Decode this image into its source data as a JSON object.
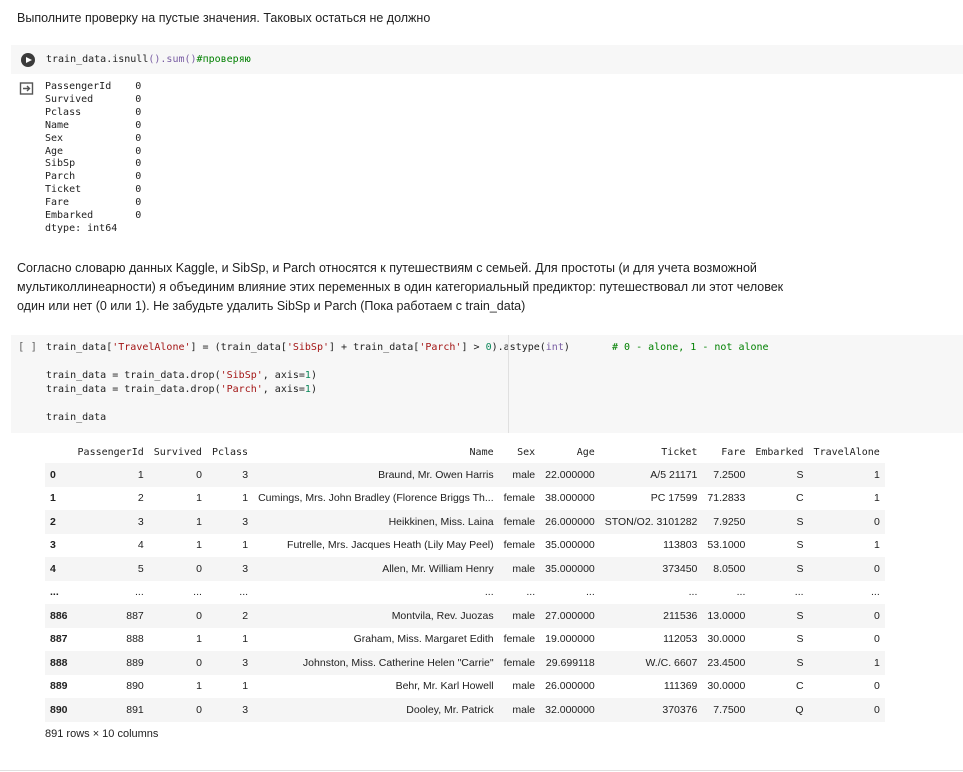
{
  "markdown_1": "Выполните проверку на пустые значения. Таковых остаться не должно",
  "cell_1": {
    "tokens": [
      "train_data.isnull",
      "()",
      ".sum",
      "()",
      "#проверяю"
    ]
  },
  "output_1": {
    "rows": [
      [
        "PassengerId",
        "0"
      ],
      [
        "Survived",
        "0"
      ],
      [
        "Pclass",
        "0"
      ],
      [
        "Name",
        "0"
      ],
      [
        "Sex",
        "0"
      ],
      [
        "Age",
        "0"
      ],
      [
        "SibSp",
        "0"
      ],
      [
        "Parch",
        "0"
      ],
      [
        "Ticket",
        "0"
      ],
      [
        "Fare",
        "0"
      ],
      [
        "Embarked",
        "0"
      ]
    ],
    "dtype": "dtype: int64"
  },
  "markdown_2": "Согласно словарю данных Kaggle, и SibSp, и Parch относятся к путешествиям с семьей. Для простоты (и для учета возможной мультиколлинеарности) я объединим влияние этих переменных в один категориальный предиктор: путешествовал ли этот человек один или нет (0 или 1). Не забудьте удалить SibSp и Parch (Пока работаем с train_data)",
  "cell_2": {
    "exec_count": "[ ]",
    "lines": [
      "train_data['TravelAlone'] = (train_data['SibSp'] + train_data['Parch'] > 0).astype(int)       # 0 - alone, 1 - not alone",
      "",
      "train_data = train_data.drop('SibSp', axis=1)",
      "train_data = train_data.drop('Parch', axis=1)",
      "",
      "train_data"
    ]
  },
  "dataframe": {
    "columns": [
      "",
      "PassengerId",
      "Survived",
      "Pclass",
      "Name",
      "Sex",
      "Age",
      "Ticket",
      "Fare",
      "Embarked",
      "TravelAlone"
    ],
    "rows": [
      [
        "0",
        "1",
        "0",
        "3",
        "Braund, Mr. Owen Harris",
        "male",
        "22.000000",
        "A/5 21171",
        "7.2500",
        "S",
        "1"
      ],
      [
        "1",
        "2",
        "1",
        "1",
        "Cumings, Mrs. John Bradley (Florence Briggs Th...",
        "female",
        "38.000000",
        "PC 17599",
        "71.2833",
        "C",
        "1"
      ],
      [
        "2",
        "3",
        "1",
        "3",
        "Heikkinen, Miss. Laina",
        "female",
        "26.000000",
        "STON/O2. 3101282",
        "7.9250",
        "S",
        "0"
      ],
      [
        "3",
        "4",
        "1",
        "1",
        "Futrelle, Mrs. Jacques Heath (Lily May Peel)",
        "female",
        "35.000000",
        "113803",
        "53.1000",
        "S",
        "1"
      ],
      [
        "4",
        "5",
        "0",
        "3",
        "Allen, Mr. William Henry",
        "male",
        "35.000000",
        "373450",
        "8.0500",
        "S",
        "0"
      ],
      [
        "...",
        "...",
        "...",
        "...",
        "...",
        "...",
        "...",
        "...",
        "...",
        "...",
        "..."
      ],
      [
        "886",
        "887",
        "0",
        "2",
        "Montvila, Rev. Juozas",
        "male",
        "27.000000",
        "211536",
        "13.0000",
        "S",
        "0"
      ],
      [
        "887",
        "888",
        "1",
        "1",
        "Graham, Miss. Margaret Edith",
        "female",
        "19.000000",
        "112053",
        "30.0000",
        "S",
        "0"
      ],
      [
        "888",
        "889",
        "0",
        "3",
        "Johnston, Miss. Catherine Helen \"Carrie\"",
        "female",
        "29.699118",
        "W./C. 6607",
        "23.4500",
        "S",
        "1"
      ],
      [
        "889",
        "890",
        "1",
        "1",
        "Behr, Mr. Karl Howell",
        "male",
        "26.000000",
        "111369",
        "30.0000",
        "C",
        "0"
      ],
      [
        "890",
        "891",
        "0",
        "3",
        "Dooley, Mr. Patrick",
        "male",
        "32.000000",
        "370376",
        "7.7500",
        "Q",
        "0"
      ]
    ],
    "shape_text": "891 rows × 10 columns"
  },
  "colors": {
    "cell_bg": "#f7f7f7",
    "string": "#a31515",
    "number": "#098658",
    "comment": "#008000",
    "function": "#795da3"
  }
}
